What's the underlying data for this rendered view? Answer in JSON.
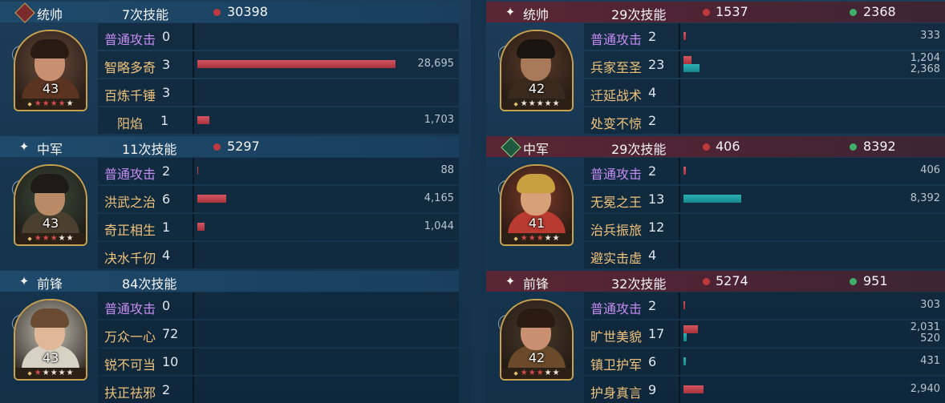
{
  "colors": {
    "damage": "#c0393f",
    "heal": "#3fae6a",
    "skill_basic": "#c58cf0",
    "skill_normal": "#f0c27a"
  },
  "left": [
    {
      "role": "统帅",
      "role_icon": "banner-icon",
      "skills": "7次技能",
      "damage": "30398",
      "heal": null,
      "level": "43",
      "badge_icon": "brush-icon",
      "red_stars": 4,
      "white_stars": 1,
      "rows": [
        {
          "name": "普通攻击",
          "count": "0",
          "basic": true,
          "indent": false,
          "red": 0,
          "teal": 0,
          "v1": "",
          "v2": ""
        },
        {
          "name": "智略多奇",
          "count": "3",
          "basic": false,
          "indent": false,
          "red": 247,
          "teal": 0,
          "v1": "28,695",
          "v2": ""
        },
        {
          "name": "百炼千锤",
          "count": "3",
          "basic": false,
          "indent": false,
          "red": 0,
          "teal": 0,
          "v1": "",
          "v2": ""
        },
        {
          "name": "阳焰",
          "count": "1",
          "basic": false,
          "indent": true,
          "red": 15,
          "teal": 0,
          "v1": "1,703",
          "v2": ""
        }
      ]
    },
    {
      "role": "中军",
      "role_icon": "spark-icon",
      "skills": "11次技能",
      "damage": "5297",
      "heal": null,
      "level": "43",
      "badge_icon": "brush-icon",
      "red_stars": 3,
      "white_stars": 2,
      "rows": [
        {
          "name": "普通攻击",
          "count": "2",
          "basic": true,
          "indent": false,
          "red": 1,
          "teal": 0,
          "v1": "88",
          "v2": ""
        },
        {
          "name": "洪武之治",
          "count": "6",
          "basic": false,
          "indent": false,
          "red": 36,
          "teal": 0,
          "v1": "4,165",
          "v2": ""
        },
        {
          "name": "奇正相生",
          "count": "1",
          "basic": false,
          "indent": false,
          "red": 9,
          "teal": 0,
          "v1": "1,044",
          "v2": ""
        },
        {
          "name": "决水千仞",
          "count": "4",
          "basic": false,
          "indent": false,
          "red": 0,
          "teal": 0,
          "v1": "",
          "v2": ""
        }
      ]
    },
    {
      "role": "前锋",
      "role_icon": "spark-icon",
      "skills": "84次技能",
      "damage": null,
      "heal": null,
      "level": "43",
      "badge_icon": "cloud-icon",
      "red_stars": 1,
      "white_stars": 4,
      "rows": [
        {
          "name": "普通攻击",
          "count": "0",
          "basic": true,
          "indent": false,
          "red": 0,
          "teal": 0,
          "v1": "",
          "v2": ""
        },
        {
          "name": "万众一心",
          "count": "72",
          "basic": false,
          "indent": false,
          "red": 0,
          "teal": 0,
          "v1": "",
          "v2": ""
        },
        {
          "name": "锐不可当",
          "count": "10",
          "basic": false,
          "indent": false,
          "red": 0,
          "teal": 0,
          "v1": "",
          "v2": ""
        },
        {
          "name": "扶正祛邪",
          "count": "2",
          "basic": false,
          "indent": false,
          "red": 0,
          "teal": 0,
          "v1": "",
          "v2": ""
        }
      ]
    }
  ],
  "right": [
    {
      "role": "统帅",
      "role_icon": "spark-icon",
      "skills": "29次技能",
      "damage": "1537",
      "heal": "2368",
      "level": "42",
      "badge_icon": "dragon-icon",
      "red_stars": 0,
      "white_stars": 5,
      "rows": [
        {
          "name": "普通攻击",
          "count": "2",
          "basic": true,
          "indent": false,
          "red": 3,
          "teal": 0,
          "v1": "333",
          "v2": ""
        },
        {
          "name": "兵家至圣",
          "count": "23",
          "basic": false,
          "indent": false,
          "red": 10,
          "teal": 20,
          "v1": "1,204",
          "v2": "2,368"
        },
        {
          "name": "迁延战术",
          "count": "4",
          "basic": false,
          "indent": false,
          "red": 0,
          "teal": 0,
          "v1": "",
          "v2": ""
        },
        {
          "name": "处变不惊",
          "count": "2",
          "basic": false,
          "indent": false,
          "red": 0,
          "teal": 0,
          "v1": "",
          "v2": ""
        }
      ]
    },
    {
      "role": "中军",
      "role_icon": "heart-icon",
      "skills": "29次技能",
      "damage": "406",
      "heal": "8392",
      "level": "41",
      "badge_icon": "dragon-icon",
      "red_stars": 3,
      "white_stars": 2,
      "rows": [
        {
          "name": "普通攻击",
          "count": "2",
          "basic": true,
          "indent": false,
          "red": 3,
          "teal": 0,
          "v1": "406",
          "v2": ""
        },
        {
          "name": "无冕之王",
          "count": "13",
          "basic": false,
          "indent": false,
          "red": 0,
          "teal": 72,
          "v1": "8,392",
          "v2": ""
        },
        {
          "name": "治兵振旅",
          "count": "12",
          "basic": false,
          "indent": false,
          "red": 0,
          "teal": 0,
          "v1": "",
          "v2": ""
        },
        {
          "name": "避实击虚",
          "count": "4",
          "basic": false,
          "indent": false,
          "red": 0,
          "teal": 0,
          "v1": "",
          "v2": ""
        }
      ]
    },
    {
      "role": "前锋",
      "role_icon": "spark-icon",
      "skills": "32次技能",
      "damage": "5274",
      "heal": "951",
      "level": "42",
      "badge_icon": "cloud-icon",
      "red_stars": 3,
      "white_stars": 2,
      "rows": [
        {
          "name": "普通攻击",
          "count": "2",
          "basic": true,
          "indent": false,
          "red": 2,
          "teal": 0,
          "v1": "303",
          "v2": ""
        },
        {
          "name": "旷世美貌",
          "count": "17",
          "basic": false,
          "indent": false,
          "red": 18,
          "teal": 4,
          "v1": "2,031",
          "v2": "520"
        },
        {
          "name": "镇卫护军",
          "count": "6",
          "basic": false,
          "indent": false,
          "red": 0,
          "teal": 3,
          "v1": "431",
          "v2": ""
        },
        {
          "name": "护身真言",
          "count": "9",
          "basic": false,
          "indent": false,
          "red": 25,
          "teal": 0,
          "v1": "2,940",
          "v2": ""
        }
      ]
    }
  ]
}
